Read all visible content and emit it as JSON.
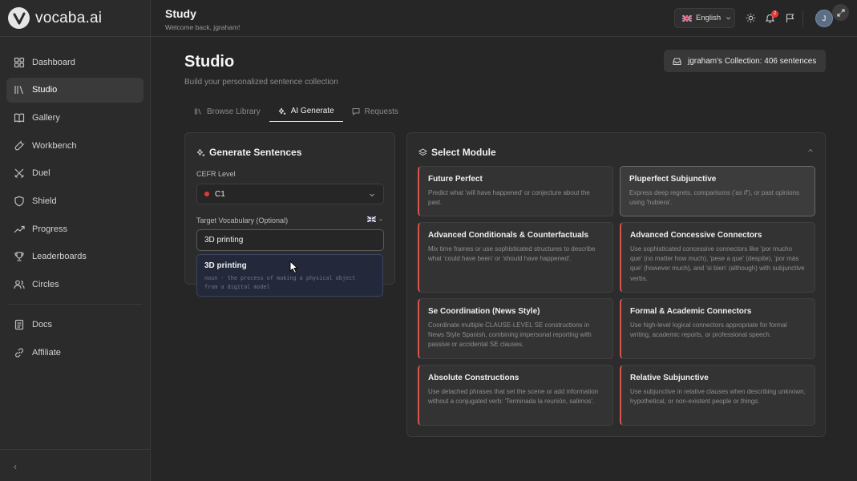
{
  "app": {
    "name": "vocaba.ai"
  },
  "sidebar": {
    "items": [
      {
        "label": "Dashboard",
        "icon": "grid-icon"
      },
      {
        "label": "Studio",
        "icon": "library-icon",
        "active": true
      },
      {
        "label": "Gallery",
        "icon": "book-icon"
      },
      {
        "label": "Workbench",
        "icon": "wrench-icon"
      },
      {
        "label": "Duel",
        "icon": "swords-icon"
      },
      {
        "label": "Shield",
        "icon": "shield-icon"
      },
      {
        "label": "Progress",
        "icon": "trend-icon"
      },
      {
        "label": "Leaderboards",
        "icon": "trophy-icon"
      },
      {
        "label": "Circles",
        "icon": "users-icon"
      }
    ],
    "secondary": [
      {
        "label": "Docs",
        "icon": "document-icon"
      },
      {
        "label": "Affiliate",
        "icon": "link-icon"
      }
    ],
    "collapse_glyph": "‹"
  },
  "topbar": {
    "title": "Study",
    "subtitle": "Welcome back, jgraham!",
    "language": "English",
    "notification_count": "2",
    "avatar_initial": "J"
  },
  "main": {
    "title": "Studio",
    "subtitle": "Build your personalized sentence collection",
    "collection": "jgraham's Collection: 406 sentences",
    "tabs": [
      {
        "label": "Browse Library",
        "icon": "library-icon"
      },
      {
        "label": "AI Generate",
        "icon": "sparkle-icon",
        "active": true
      },
      {
        "label": "Requests",
        "icon": "message-icon"
      }
    ]
  },
  "generate": {
    "title": "Generate Sentences",
    "cefr_label": "CEFR Level",
    "cefr_value": "C1",
    "vocab_label": "Target Vocabulary (Optional)",
    "vocab_value": "3D printing",
    "suggestion": {
      "word": "3D printing",
      "definition_line1": "noun · the process of making a physical object",
      "definition_line2": "from a digital model"
    }
  },
  "module": {
    "title": "Select Module",
    "cards": [
      {
        "title": "Future Perfect",
        "desc": "Predict what 'will have happened' or conjecture about the past."
      },
      {
        "title": "Pluperfect Subjunctive",
        "desc": "Express deep regrets, comparisons ('as if'), or past opinions using 'hubiera'.",
        "selected": true
      },
      {
        "title": "Advanced Conditionals & Counterfactuals",
        "desc": "Mix time frames or use sophisticated structures to describe what 'could have been' or 'should have happened'."
      },
      {
        "title": "Advanced Concessive Connectors",
        "desc": "Use sophisticated concessive connectors like 'por mucho que' (no matter how much), 'pese a que' (despite), 'por más que' (however much), and 'si bien' (although) with subjunctive verbs."
      },
      {
        "title": "Se Coordination (News Style)",
        "desc": "Coordinate multiple CLAUSE-LEVEL SE constructions in News Style Spanish, combining impersonal reporting with passive or accidental SE clauses."
      },
      {
        "title": "Formal & Academic Connectors",
        "desc": "Use high-level logical connectors appropriate for formal writing, academic reports, or professional speech."
      },
      {
        "title": "Absolute Constructions",
        "desc": "Use detached phrases that set the scene or add information without a conjugated verb: 'Terminada la reunión, salimos'."
      },
      {
        "title": "Relative Subjunctive",
        "desc": "Use subjunctive in relative clauses when describing unknown, hypothetical, or non-existent people or things."
      }
    ]
  },
  "colors": {
    "background": "#262626",
    "panel": "#2c2c2c",
    "card_accent": "#d9534f",
    "badge": "#e53935"
  }
}
